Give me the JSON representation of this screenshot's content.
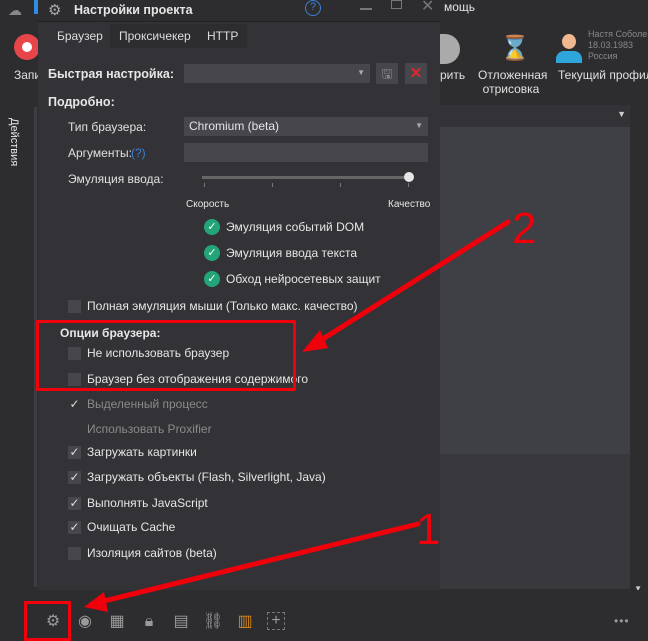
{
  "app": {
    "menu_help": "мощь",
    "ribbon": {
      "record": "Запи",
      "save": "рить",
      "deferred": [
        "Отложенная",
        "отрисовка"
      ],
      "profile": "Текущий профиль",
      "profile_info": [
        "Настя Соболе",
        "18.03.1983",
        "Россия"
      ]
    },
    "side_tab": "Действия"
  },
  "dialog": {
    "title": "Настройки проекта",
    "tabs": [
      "Браузер",
      "Проксичекер",
      "HTTP"
    ],
    "quick_label": "Быстрая настройка:",
    "quick_value": "",
    "details_header": "Подробно:",
    "browser_type_label": "Тип браузера:",
    "browser_type_value": "Chromium (beta)",
    "args_label": "Аргументы:",
    "args_help": "(?)",
    "args_value": "",
    "input_emulation_label": "Эмуляция ввода:",
    "slider_min": "Скорость",
    "slider_max": "Качество",
    "slider_value_fraction": 1.0,
    "emulation_options": [
      "Эмуляция событий DOM",
      "Эмуляция ввода текста",
      "Обход нейросетевых защит"
    ],
    "full_mouse": {
      "label": "Полная эмуляция мыши (Только макс. качество)",
      "checked": false
    },
    "browser_options_header": "Опции браузера:",
    "options": [
      {
        "label": "Не использовать браузер",
        "checked": false,
        "enabled": true,
        "box": true
      },
      {
        "label": "Браузер без отображения содержимого",
        "checked": false,
        "enabled": true,
        "box": true
      },
      {
        "label": "Выделенный процесс",
        "checked": true,
        "enabled": false,
        "box": false
      },
      {
        "label": "Использовать Proxifier",
        "checked": false,
        "enabled": false,
        "box": false
      },
      {
        "label": "Загружать картинки",
        "checked": true,
        "enabled": true,
        "box": true
      },
      {
        "label": "Загружать объекты (Flash, Silverlight, Java)",
        "checked": true,
        "enabled": true,
        "box": true
      },
      {
        "label": "Выполнять JavaScript",
        "checked": true,
        "enabled": true,
        "box": true
      },
      {
        "label": "Очищать Cache",
        "checked": true,
        "enabled": true,
        "box": true
      },
      {
        "label": "Изоляция сайтов (beta)",
        "checked": false,
        "enabled": true,
        "box": true
      }
    ]
  },
  "bottom_toolbar": [
    "gear-icon",
    "profile-icon",
    "grid-icon",
    "lock-icon",
    "code-file-icon",
    "link-icon",
    "layout-icon",
    "add-icon",
    "more-icon"
  ],
  "annotations": {
    "num1": "1",
    "num2": "2",
    "color": "#f0000a"
  },
  "colors": {
    "accent_green": "#23a479",
    "close_red": "#e0282c",
    "help_blue": "#3a7fd5",
    "layout_orange": "#d4861c"
  }
}
